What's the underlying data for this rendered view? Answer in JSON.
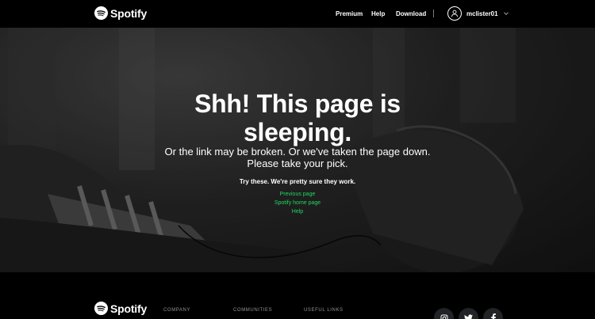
{
  "header": {
    "brand": "Spotify",
    "nav": {
      "premium": "Premium",
      "help": "Help",
      "download": "Download"
    },
    "user": {
      "name": "mclister01"
    }
  },
  "hero": {
    "title_line1": "Shh! This page is",
    "title_line2": "sleeping.",
    "subtitle_line1": "Or the link may be broken. Or we've taken the page down.",
    "subtitle_line2": "Please take your pick.",
    "try_label": "Try these. We're pretty sure they work.",
    "links": [
      "Previous page",
      "Spotify home page",
      "Help"
    ]
  },
  "footer": {
    "brand": "Spotify",
    "columns": [
      "COMPANY",
      "COMMUNITIES",
      "USEFUL LINKS"
    ],
    "social": [
      "instagram-icon",
      "twitter-icon",
      "facebook-icon"
    ]
  },
  "colors": {
    "accent": "#1ed760",
    "background": "#000000"
  }
}
